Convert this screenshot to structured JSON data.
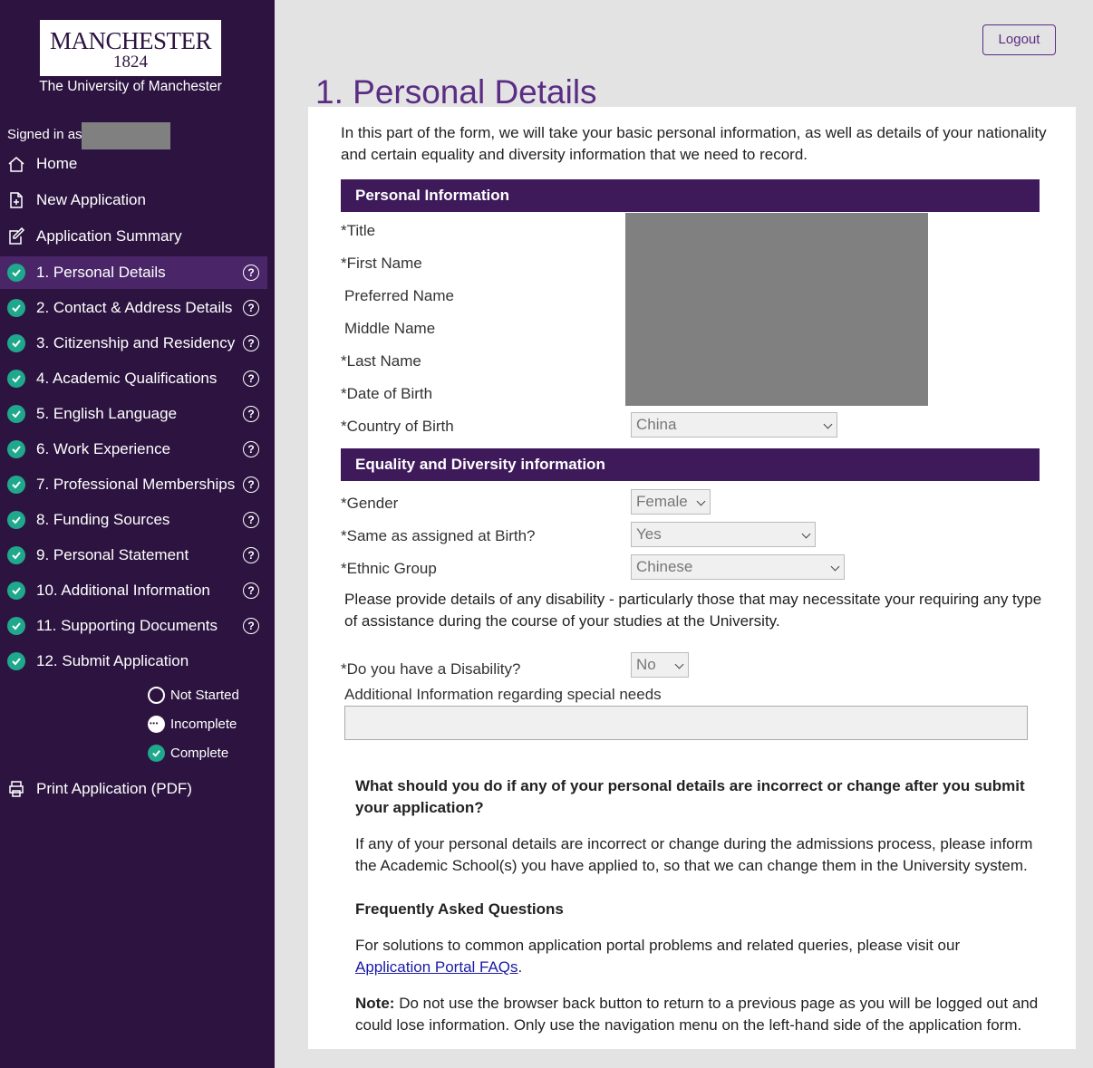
{
  "sidebar": {
    "logo_line1": "MANCHESTER",
    "logo_line2": "1824",
    "logo_sub": "The University of Manchester",
    "signed_in": "Signed in as",
    "nav": [
      {
        "label": "Home",
        "icon": "home-icon"
      },
      {
        "label": "New Application",
        "icon": "new-document-icon"
      },
      {
        "label": "Application Summary",
        "icon": "edit-document-icon"
      }
    ],
    "steps": [
      {
        "label": "1. Personal Details",
        "status": "complete",
        "help": true,
        "active": true
      },
      {
        "label": "2. Contact & Address Details",
        "status": "complete",
        "help": true
      },
      {
        "label": "3. Citizenship and Residency",
        "status": "complete",
        "help": true
      },
      {
        "label": "4. Academic Qualifications",
        "status": "complete",
        "help": true
      },
      {
        "label": "5. English Language",
        "status": "complete",
        "help": true
      },
      {
        "label": "6. Work Experience",
        "status": "complete",
        "help": true
      },
      {
        "label": "7. Professional Memberships",
        "status": "complete",
        "help": true
      },
      {
        "label": "8. Funding Sources",
        "status": "complete",
        "help": true
      },
      {
        "label": "9. Personal Statement",
        "status": "complete",
        "help": true
      },
      {
        "label": "10. Additional Information",
        "status": "complete",
        "help": true
      },
      {
        "label": "11. Supporting Documents",
        "status": "complete",
        "help": true
      },
      {
        "label": "12. Submit Application",
        "status": "complete",
        "help": false
      }
    ],
    "help_glyph": "?",
    "legend": [
      "Not Started",
      "Incomplete",
      "Complete"
    ],
    "print_label": "Print Application (PDF)",
    "accent_complete": "#1fa88c"
  },
  "header": {
    "logout": "Logout",
    "title": "1. Personal Details"
  },
  "form": {
    "intro": "In this part of the form, we will take your basic personal information, as well as details of your nationality and certain equality and diversity information that we need to record.",
    "section1": "Personal Information",
    "fields1": [
      "*Title",
      "*First Name",
      "Preferred Name",
      "Middle Name",
      "*Last Name",
      "*Date of Birth",
      "*Country of Birth"
    ],
    "country_of_birth": "China",
    "section2": "Equality and Diversity information",
    "gender_label": "*Gender",
    "gender_value": "Female",
    "same_birth_label": "*Same as assigned at Birth?",
    "same_birth_value": "Yes",
    "ethnic_label": "*Ethnic Group",
    "ethnic_value": "Chinese",
    "disability_note": "Please provide details of any disability - particularly those that may necessitate your requiring any type of assistance during the course of your studies at the University.",
    "disability_label": "*Do you have a Disability?",
    "disability_value": "No",
    "special_needs_label": "Additional Information regarding special needs",
    "special_needs_value": ""
  },
  "info": {
    "q1": "What should you do if any of your personal details are incorrect or change after you submit your application?",
    "a1": "If any of your personal details are incorrect or change during the admissions process, please inform the Academic School(s) you have applied to, so that we can change them in the University system.",
    "faq_title": "Frequently Asked Questions",
    "faq_text": "For solutions to common application portal problems and related queries, please visit our",
    "faq_link": "Application Portal FAQs",
    "faq_end": ".",
    "note_label": "Note:",
    "note_text": "Do not use the browser back button to return to a previous page as you will be logged out and could lose information. Only use the navigation menu on the left-hand side of the application form."
  }
}
